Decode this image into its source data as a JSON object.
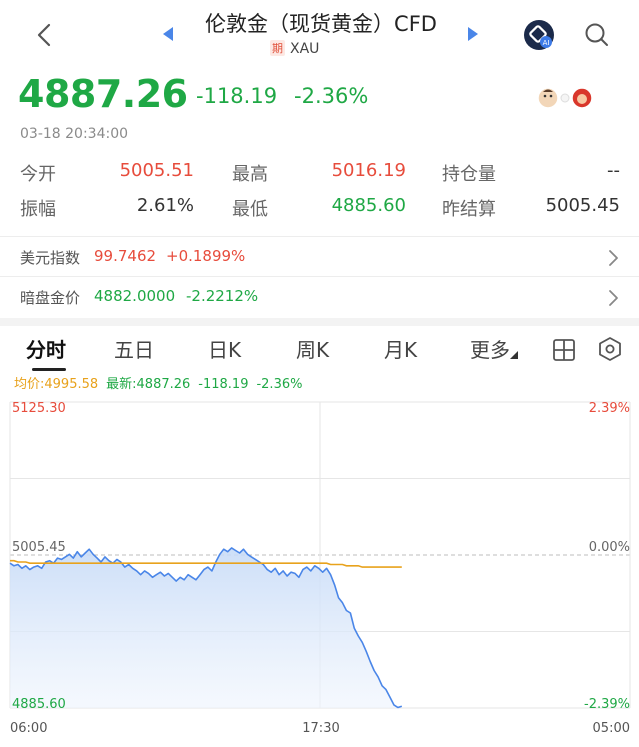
{
  "nav": {
    "title": "伦敦金（现货黄金）CFD",
    "tag": "期",
    "code": "XAU"
  },
  "quote": {
    "price": "4887.26",
    "change": "-118.19",
    "change_pct": "-2.36%",
    "timestamp": "03-18 20:34:00"
  },
  "stats": {
    "open_label": "今开",
    "open_value": "5005.51",
    "high_label": "最高",
    "high_value": "5016.19",
    "oi_label": "持仓量",
    "oi_value": "--",
    "amp_label": "振幅",
    "amp_value": "2.61%",
    "low_label": "最低",
    "low_value": "4885.60",
    "prev_label": "昨结算",
    "prev_value": "5005.45"
  },
  "related": [
    {
      "label": "美元指数",
      "value": "99.7462",
      "change": "+0.1899%"
    },
    {
      "label": "暗盘金价",
      "value": "4882.0000",
      "change": "-2.2212%"
    }
  ],
  "tabs": [
    "分时",
    "五日",
    "日K",
    "周K",
    "月K",
    "更多"
  ],
  "legend": {
    "avg": "均价:4995.58",
    "latest": "最新:4887.26",
    "change": "-118.19",
    "change_pct": "-2.36%"
  },
  "colors": {
    "up": "#e74c3c",
    "down": "#1fa845",
    "line": "#4a86e8",
    "avg": "#e8a21c"
  },
  "chart_data": {
    "type": "line",
    "y_top_label": "5125.30",
    "y_mid_label": "5005.45",
    "y_bottom_label": "4885.60",
    "pct_top": "2.39%",
    "pct_mid": "0.00%",
    "pct_bottom": "-2.39%",
    "x_labels": [
      "06:00",
      "17:30",
      "05:00"
    ],
    "ylim": [
      4885.6,
      5125.3
    ],
    "prev_close": 5005.45,
    "price_series": [
      4999,
      4997,
      4998,
      4995,
      4997,
      4994,
      4996,
      4997,
      4995,
      5000,
      5001,
      4999,
      5003,
      5002,
      5004,
      5006,
      5003,
      5008,
      5004,
      5007,
      5010,
      5006,
      5003,
      5000,
      5004,
      5001,
      4999,
      5002,
      5000,
      4996,
      4998,
      4995,
      4993,
      4990,
      4993,
      4991,
      4988,
      4990,
      4992,
      4989,
      4991,
      4988,
      4985,
      4988,
      4986,
      4990,
      4988,
      4986,
      4990,
      4994,
      4996,
      4993,
      5000,
      5006,
      5010,
      5008,
      5011,
      5009,
      5007,
      5010,
      5006,
      5004,
      5002,
      5000,
      4998,
      4994,
      4992,
      4995,
      4990,
      4993,
      4989,
      4992,
      4991,
      4988,
      4994,
      4996,
      4993,
      4997,
      4995,
      4992,
      4995,
      4990,
      4982,
      4972,
      4968,
      4962,
      4960,
      4948,
      4942,
      4937,
      4930,
      4922,
      4915,
      4910,
      4903,
      4900,
      4894,
      4888,
      4886,
      4887
    ],
    "avg_series": [
      5001,
      5001,
      5000,
      5000,
      5000,
      4999,
      4999,
      4999,
      4999,
      4999,
      4999,
      4999,
      4999,
      4999,
      4999,
      4999,
      4999,
      4999,
      4999,
      4999,
      4999,
      4999,
      4999,
      4999,
      4999,
      4999,
      4999,
      4999,
      4999,
      4999,
      4999,
      4999,
      4999,
      4999,
      4999,
      4999,
      4999,
      4999,
      4999,
      4999,
      4999,
      4999,
      4999,
      4999,
      4999,
      4999,
      4999,
      4999,
      4999,
      4999,
      4999,
      4999,
      4999,
      4999,
      4999,
      4999,
      4999,
      4999,
      4999,
      4999,
      4999,
      4999,
      4999,
      4999,
      4999,
      4999,
      4999,
      4999,
      4999,
      4999,
      4999,
      4999,
      4999,
      4999,
      4999,
      4999,
      4999,
      4999,
      4999,
      4999,
      4999,
      4998,
      4998,
      4998,
      4998,
      4997,
      4997,
      4997,
      4997,
      4996,
      4996,
      4996,
      4996,
      4996,
      4996,
      4996,
      4996,
      4996,
      4996,
      4996
    ]
  }
}
